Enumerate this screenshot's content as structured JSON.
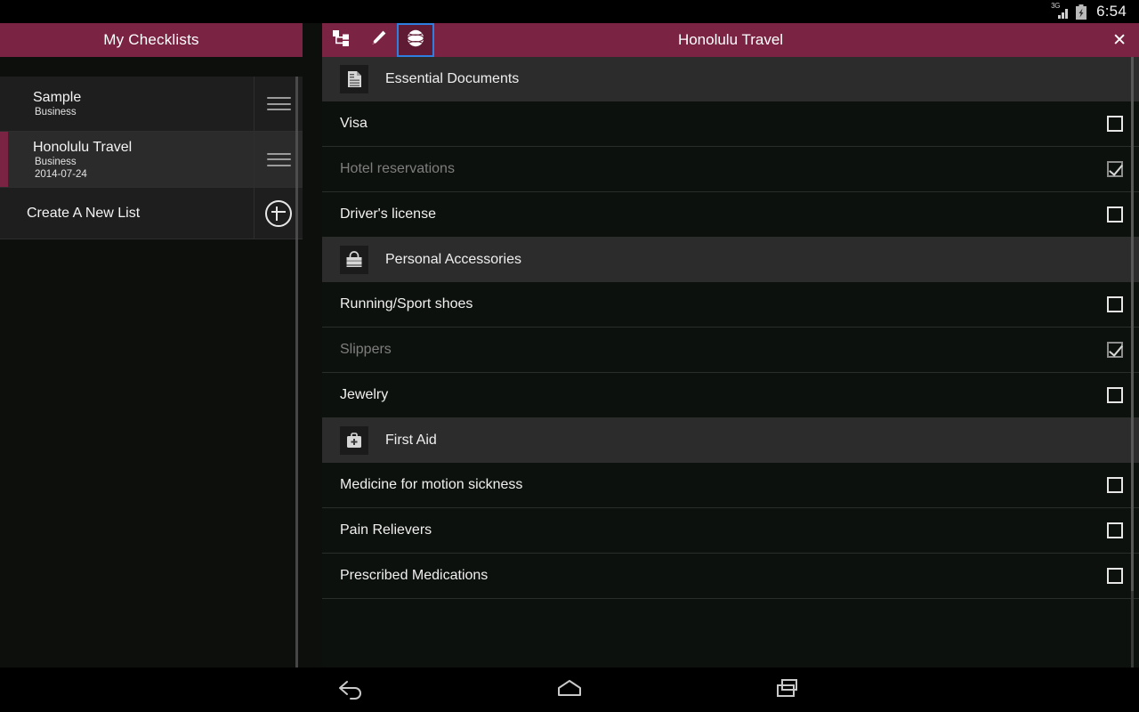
{
  "status_bar": {
    "network_label": "3G",
    "signal_icon": "signal-3g-icon",
    "battery_icon": "battery-charging-icon",
    "clock": "6:54"
  },
  "theme": {
    "accent": "#7b2342",
    "focus_outline": "#2f7fe0",
    "panel_bg": "#0d110d",
    "section_bg": "#2c2c2c",
    "done_text": "#7e7e7e"
  },
  "sidebar": {
    "header_title": "My Checklists",
    "items": [
      {
        "title": "Sample",
        "category": "Business",
        "date": "",
        "selected": false,
        "handle_icon": "drag-handle-icon"
      },
      {
        "title": "Honolulu Travel",
        "category": "Business",
        "date": "2014-07-24",
        "selected": true,
        "handle_icon": "drag-handle-icon"
      }
    ],
    "create_list": {
      "label": "Create A New List",
      "icon": "plus-circle-icon"
    }
  },
  "app_bar": {
    "title": "Honolulu Travel",
    "close_label": "✕",
    "tools": [
      {
        "name": "hierarchy-view-button",
        "icon": "hierarchy-icon",
        "focused": false
      },
      {
        "name": "edit-button",
        "icon": "pencil-icon",
        "focused": false
      },
      {
        "name": "globe-button",
        "icon": "globe-icon",
        "focused": true
      }
    ]
  },
  "checklist": {
    "sections": [
      {
        "title": "Essential Documents",
        "icon": "document-icon",
        "items": [
          {
            "label": "Visa",
            "checked": false
          },
          {
            "label": "Hotel reservations",
            "checked": true
          },
          {
            "label": "Driver's license",
            "checked": false
          }
        ]
      },
      {
        "title": "Personal Accessories",
        "icon": "bag-icon",
        "items": [
          {
            "label": "Running/Sport shoes",
            "checked": false
          },
          {
            "label": "Slippers",
            "checked": true
          },
          {
            "label": "Jewelry",
            "checked": false
          }
        ]
      },
      {
        "title": "First Aid",
        "icon": "first-aid-kit-icon",
        "items": [
          {
            "label": "Medicine for motion sickness",
            "checked": false
          },
          {
            "label": "Pain Relievers",
            "checked": false
          },
          {
            "label": "Prescribed Medications",
            "checked": false
          }
        ]
      }
    ]
  },
  "nav_bar": {
    "buttons": [
      {
        "name": "android-back-button",
        "icon": "back-arrow-icon"
      },
      {
        "name": "android-home-button",
        "icon": "home-icon"
      },
      {
        "name": "android-recents-button",
        "icon": "recents-icon"
      }
    ]
  }
}
